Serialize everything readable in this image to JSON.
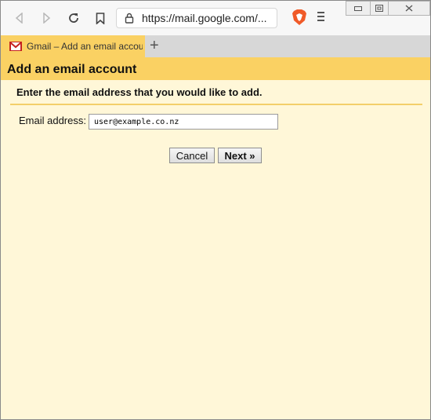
{
  "browser": {
    "url": "https://mail.google.com/...",
    "tab_title": "Gmail – Add an email account",
    "new_tab_symbol": "+",
    "icons": [
      "back-icon",
      "forward-icon",
      "reload-icon",
      "bookmark-icon",
      "lock-icon",
      "brave-lion-icon",
      "hamburger-menu-icon",
      "gmail-icon"
    ]
  },
  "page": {
    "heading": "Add an email account",
    "instruction": "Enter the email address that you would like to add.",
    "email_label": "Email address:",
    "email_value": "user@example.co.nz",
    "cancel_label": "Cancel",
    "next_label": "Next »"
  },
  "colors": {
    "header": "#fad163",
    "page_background": "#fff7d8",
    "tabstrip": "#d7d7d7"
  }
}
